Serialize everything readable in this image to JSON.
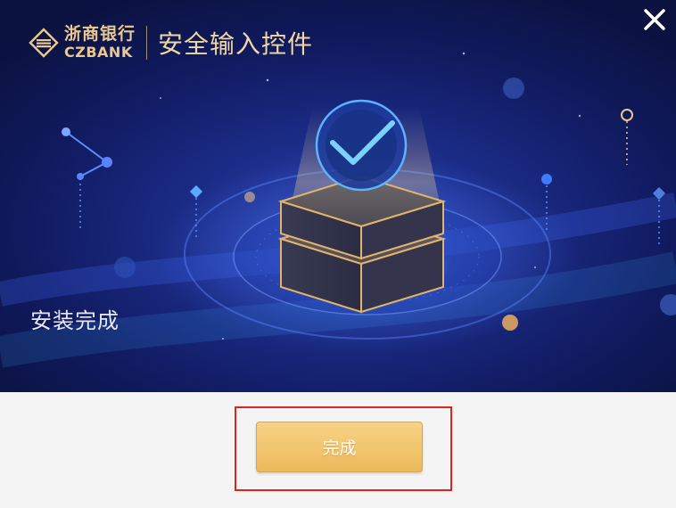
{
  "window": {
    "brand_cn": "浙商银行",
    "brand_en": "CZBANK",
    "title": "安全输入控件",
    "close_icon": "close-icon"
  },
  "hero": {
    "status": "安装完成",
    "illustration_icon": "checkmark-icon"
  },
  "footer": {
    "done_label": "完成"
  },
  "colors": {
    "gold": "#e9c98f",
    "hero_bg": "#101a5e",
    "button": "#ecb95c",
    "highlight": "#e0241b"
  }
}
